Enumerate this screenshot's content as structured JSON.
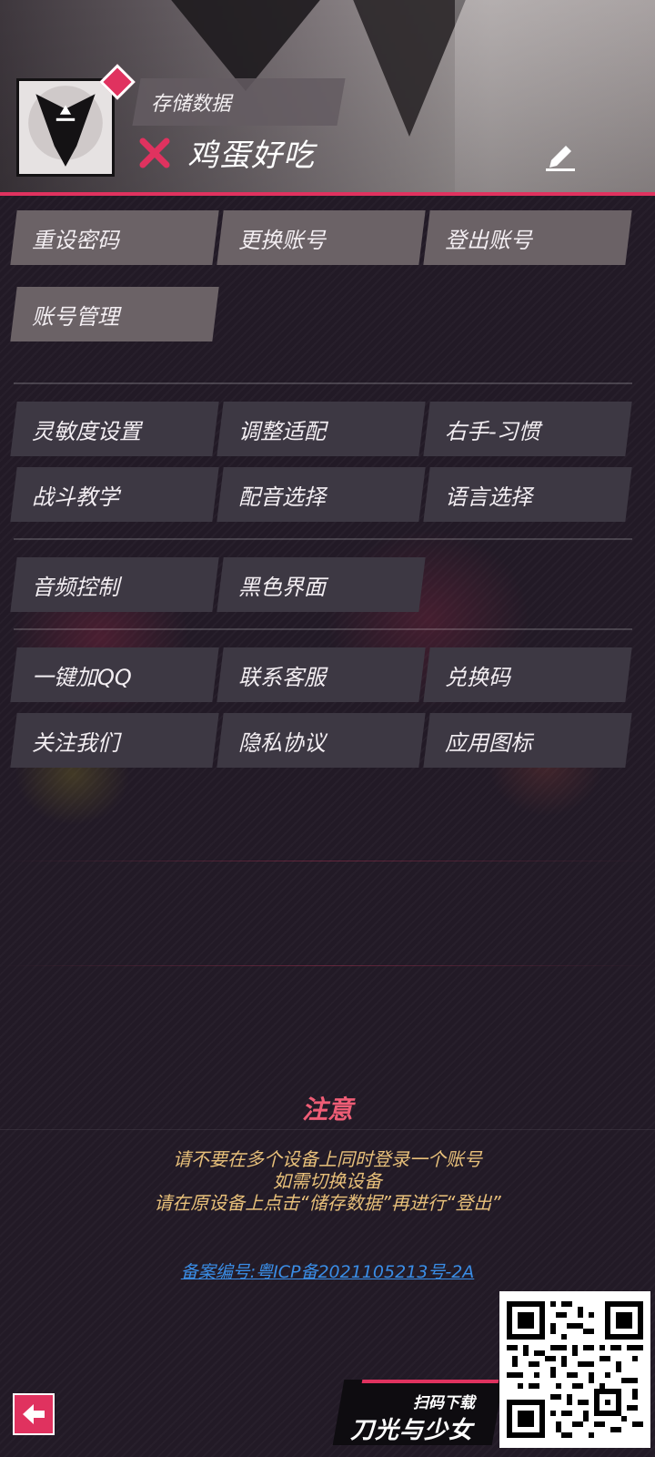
{
  "header": {
    "save_label": "存储数据",
    "username": "鸡蛋好吃"
  },
  "account_buttons": [
    {
      "label": "重设密码"
    },
    {
      "label": "更换账号"
    },
    {
      "label": "登出账号"
    },
    {
      "label": "账号管理"
    }
  ],
  "settings_buttons": [
    {
      "label": "灵敏度设置"
    },
    {
      "label": "调整适配"
    },
    {
      "label": "右手-习惯"
    },
    {
      "label": "战斗教学"
    },
    {
      "label": "配音选择"
    },
    {
      "label": "语言选择"
    }
  ],
  "media_buttons": [
    {
      "label": "音频控制"
    },
    {
      "label": "黑色界面"
    }
  ],
  "other_buttons": [
    {
      "label": "一键加QQ"
    },
    {
      "label": "联系客服"
    },
    {
      "label": "兑换码"
    },
    {
      "label": "关注我们"
    },
    {
      "label": "隐私协议"
    },
    {
      "label": "应用图标"
    }
  ],
  "notice": {
    "title": "注意",
    "lines": [
      "请不要在多个设备上同时登录一个账号",
      "如需切换设备",
      "请在原设备上点击“储存数据”再进行“登出”"
    ]
  },
  "icp": "备案编号:粤ICP备2021105213号-2A",
  "download": {
    "scan_label": "扫码下载",
    "brand": "刀光与少女"
  },
  "colors": {
    "accent": "#e0325f",
    "notice_title": "#ef5d76",
    "notice_text": "#e8c07a",
    "link": "#3a8de6"
  }
}
